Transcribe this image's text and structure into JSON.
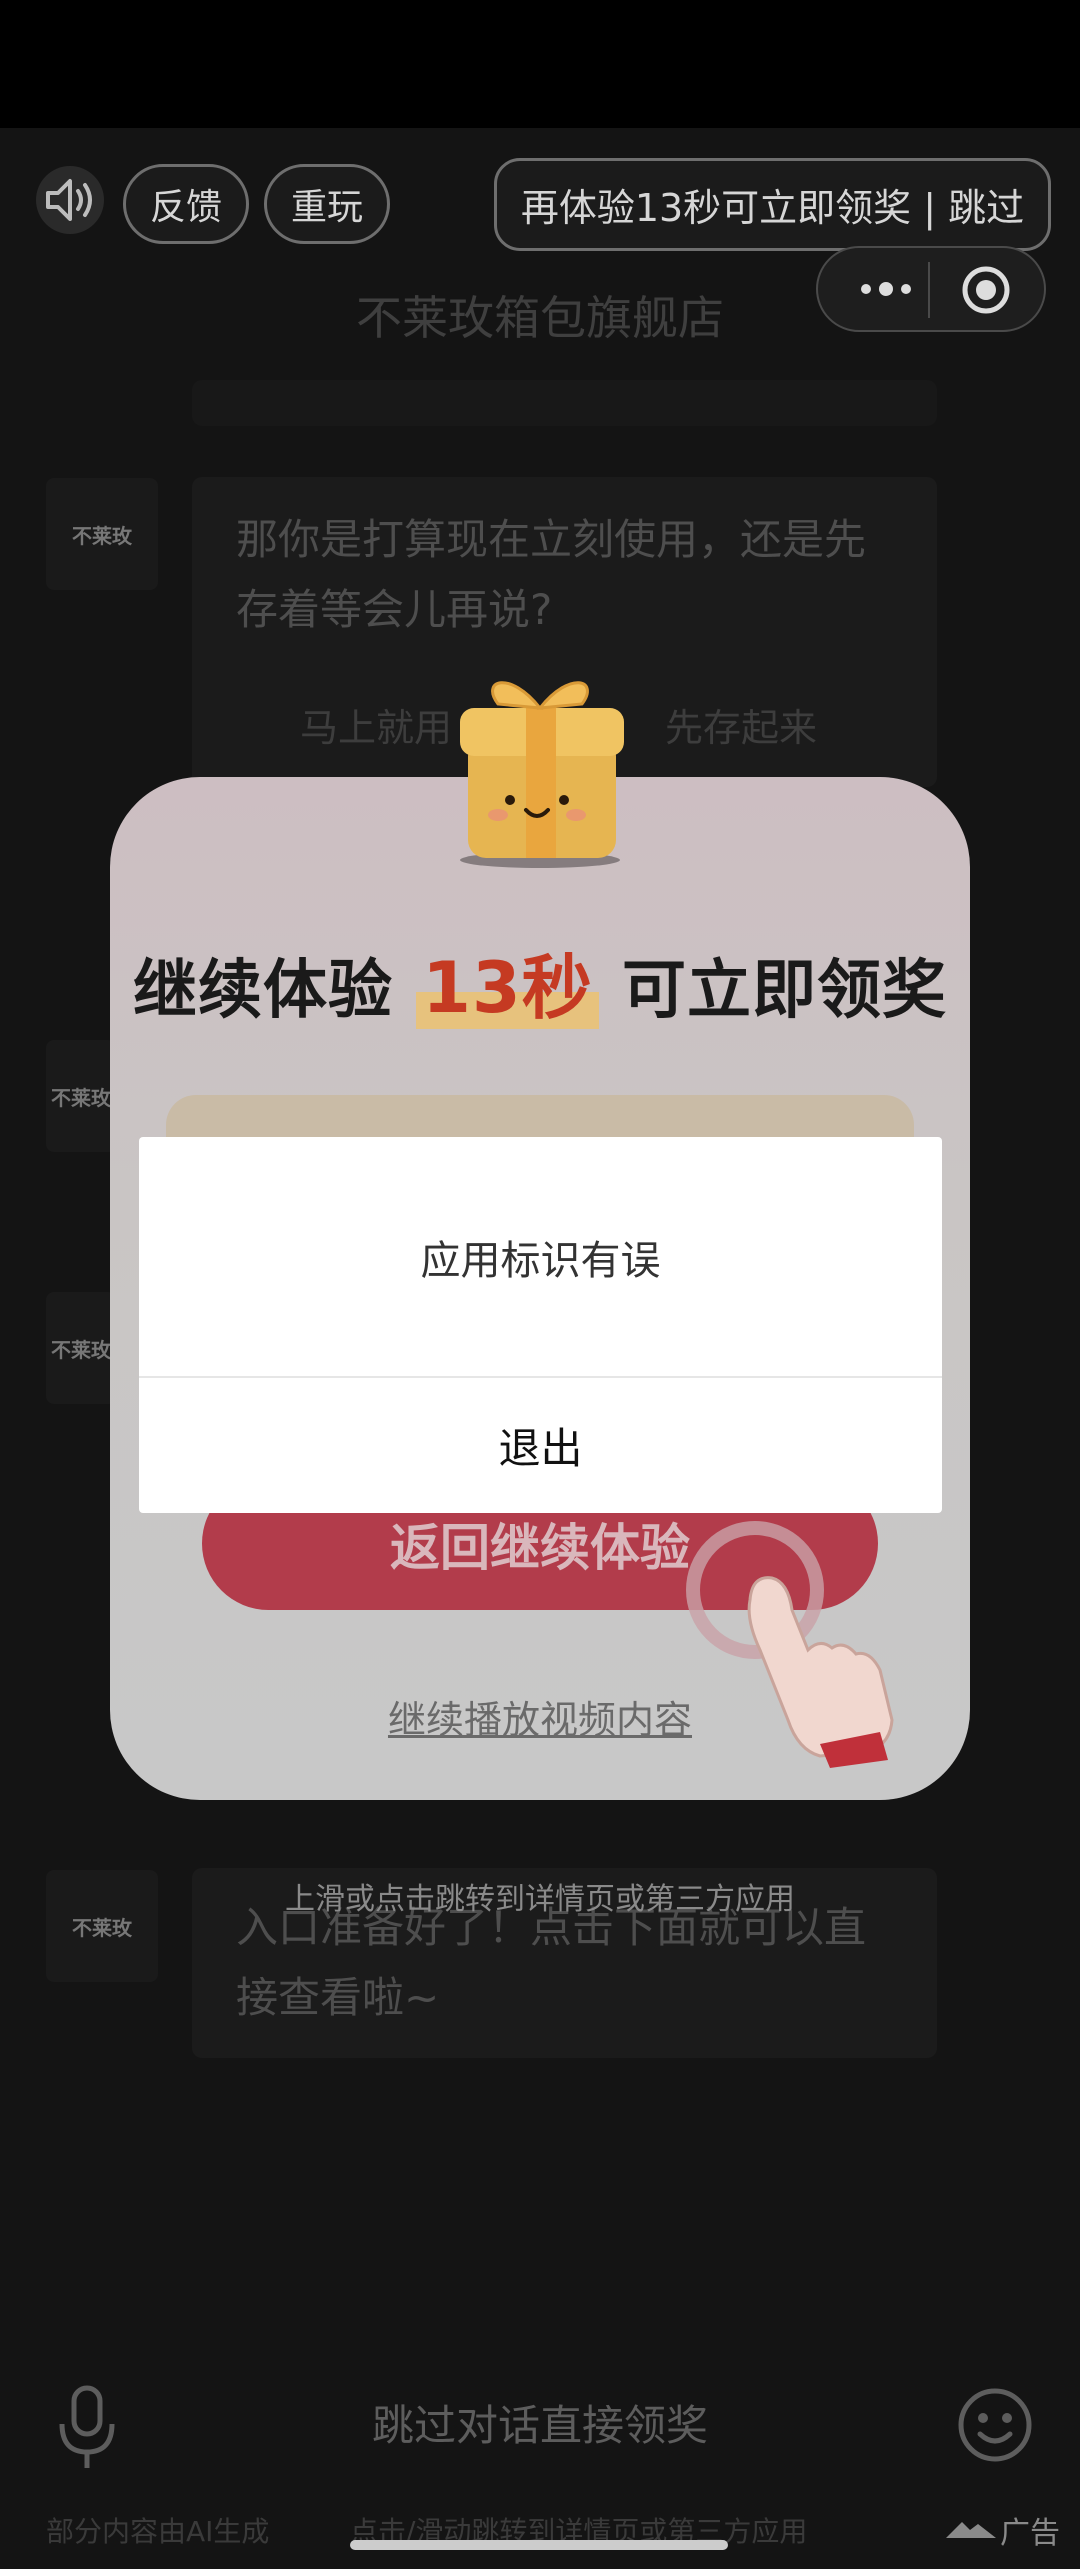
{
  "top_bar": {
    "sound_icon": "speaker-icon",
    "feedback_label": "反馈",
    "replay_label": "重玩",
    "skip_label": "再体验13秒可立即领奖 | 跳过"
  },
  "capsule": {
    "more_icon": "more-dots-icon",
    "close_icon": "target-close-icon"
  },
  "chat": {
    "store_name": "不莱玫箱包旗舰店",
    "avatar_label": "不莱玫",
    "message_1": "那你是打算现在立刻使用，还是先存着等会儿再说?",
    "option_1": "马上就用",
    "option_2": "先存起来",
    "message_last": "入口准备好了！点击下面就可以直接查看啦~",
    "swipe_hint": "上滑或点击跳转到详情页或第三方应用"
  },
  "modal": {
    "title_prefix": "继续体验",
    "title_highlight": "13秒",
    "title_suffix": "可立即领奖",
    "primary_button": "返回继续体验",
    "secondary_link": "继续播放视频内容",
    "gift_icon": "gift-box-icon",
    "hand_icon": "pointing-hand-icon"
  },
  "alert": {
    "message": "应用标识有误",
    "button": "退出"
  },
  "bottom_bar": {
    "mic_icon": "microphone-icon",
    "input_label": "跳过对话直接领奖",
    "emoji_icon": "smiley-icon",
    "ai_note": "部分内容由AI生成",
    "note2": "点击/滑动跳转到详情页或第三方应用",
    "ad_label": "广告"
  }
}
